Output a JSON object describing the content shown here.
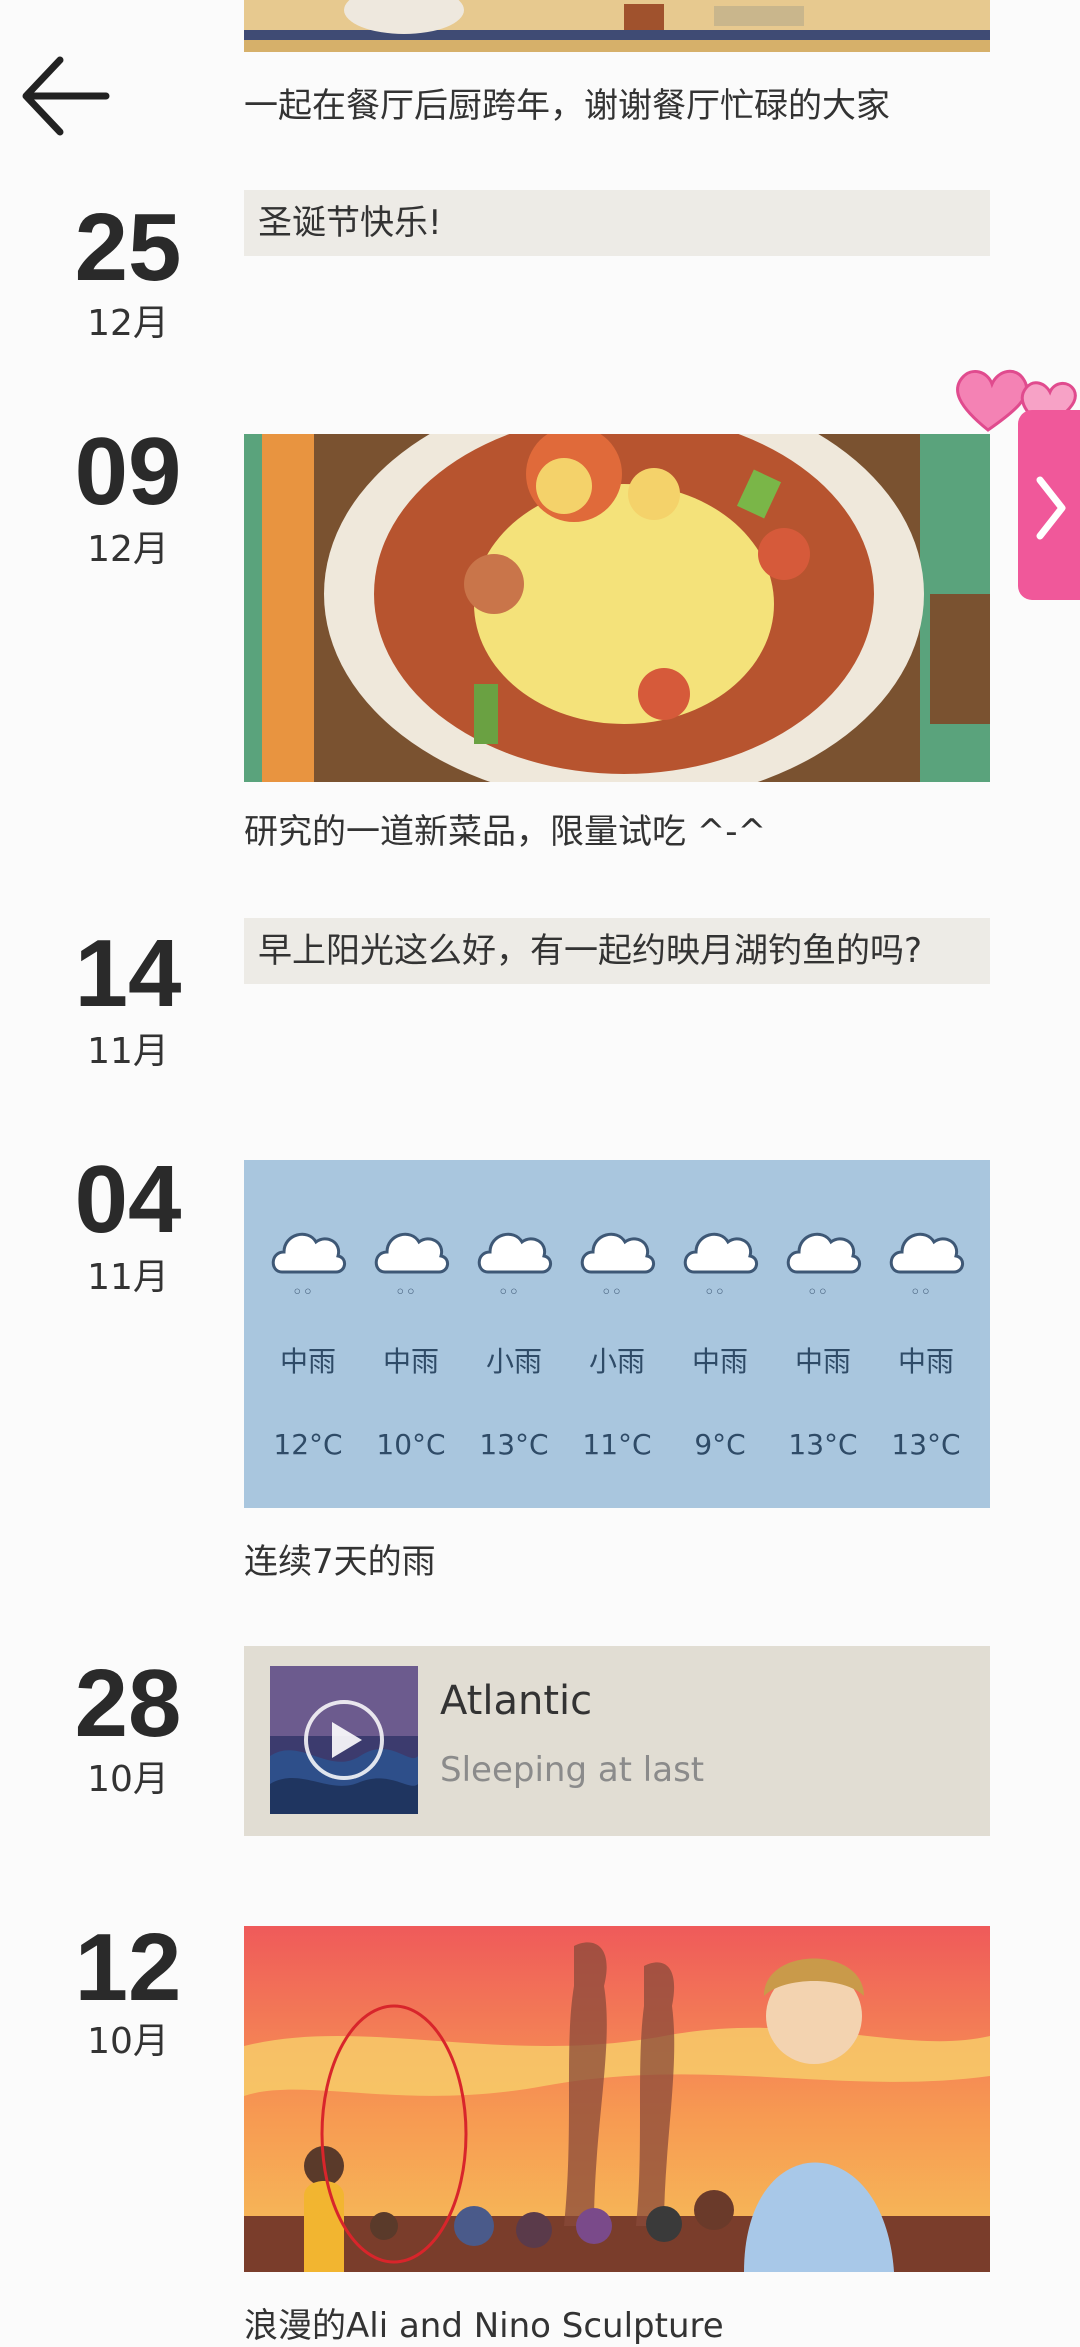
{
  "nav": {
    "back_icon": "arrow-left-icon"
  },
  "side_tab": {
    "icon": "chevron-right-icon",
    "decoration": "hearts-icon",
    "color": "#f0589a"
  },
  "entries": [
    {
      "type": "image",
      "caption": "一起在餐厅后厨跨年，谢谢餐厅忙碌的大家"
    },
    {
      "day": "25",
      "month": "12月",
      "type": "text",
      "text": "圣诞节快乐!"
    },
    {
      "day": "09",
      "month": "12月",
      "type": "image",
      "caption": "研究的一道新菜品，限量试吃 ^-^"
    },
    {
      "day": "14",
      "month": "11月",
      "type": "text",
      "text": "早上阳光这么好，有一起约映月湖钓鱼的吗?"
    },
    {
      "day": "04",
      "month": "11月",
      "type": "weather",
      "caption": "连续7天的雨",
      "forecast": [
        {
          "cond": "中雨",
          "temp": "12°C"
        },
        {
          "cond": "中雨",
          "temp": "10°C"
        },
        {
          "cond": "小雨",
          "temp": "13°C"
        },
        {
          "cond": "小雨",
          "temp": "11°C"
        },
        {
          "cond": "中雨",
          "temp": "9°C"
        },
        {
          "cond": "中雨",
          "temp": "13°C"
        },
        {
          "cond": "中雨",
          "temp": "13°C"
        }
      ]
    },
    {
      "day": "28",
      "month": "10月",
      "type": "music",
      "song": "Atlantic",
      "subtitle": "Sleeping at last",
      "play_icon": "play-icon"
    },
    {
      "day": "12",
      "month": "10月",
      "type": "image",
      "caption": "浪漫的Ali and Nino Sculpture"
    }
  ]
}
